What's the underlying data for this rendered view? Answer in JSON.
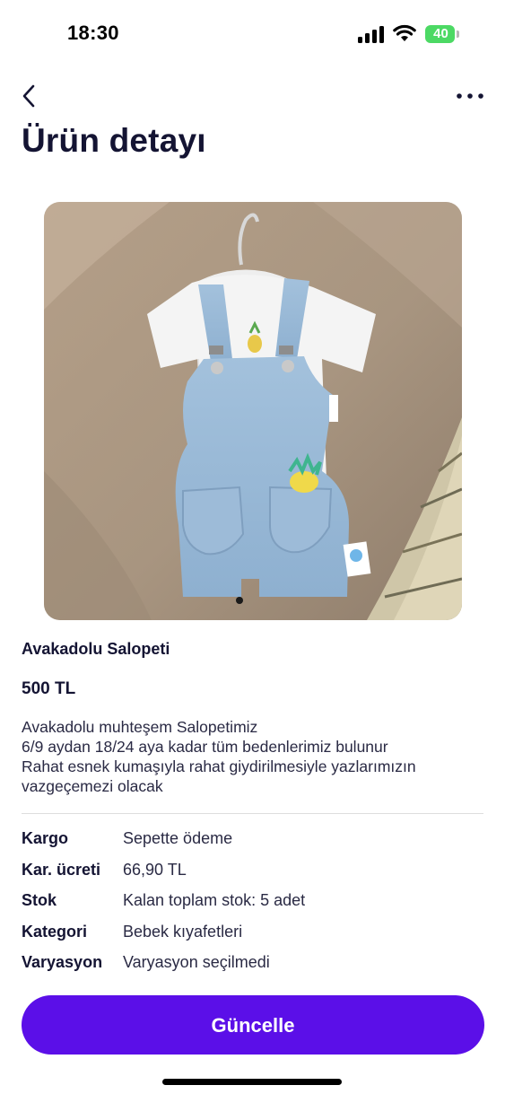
{
  "status_bar": {
    "time": "18:30",
    "battery_level": "40",
    "icons": [
      "signal-icon",
      "wifi-icon",
      "battery-icon"
    ]
  },
  "nav": {
    "back_icon": "chevron-left-icon",
    "more_icon": "more-horizontal-icon"
  },
  "page": {
    "title": "Ürün detayı"
  },
  "product": {
    "name": "Avakadolu Salopeti",
    "price": "500 TL",
    "description_lines": [
      "Avakadolu muhteşem Salopetimiz",
      "6/9 aydan 18/24 aya kadar tüm bedenlerimiz bulunur",
      "Rahat esnek kumaşıyla rahat giydirilmesiyle yazlarımızın",
      "vazgeçemezi olacak"
    ],
    "details": [
      {
        "label": "Kargo",
        "value": "Sepette ödeme"
      },
      {
        "label": "Kar. ücreti",
        "value": "66,90 TL"
      },
      {
        "label": "Stok",
        "value": "Kalan toplam stok: 5 adet"
      },
      {
        "label": "Kategori",
        "value": "Bebek kıyafetleri"
      },
      {
        "label": "Varyasyon",
        "value": "Varyasyon seçilmedi"
      }
    ]
  },
  "actions": {
    "update_label": "Güncelle"
  },
  "colors": {
    "primary": "#5b0fe8",
    "text": "#141433",
    "battery": "#4cd964"
  }
}
